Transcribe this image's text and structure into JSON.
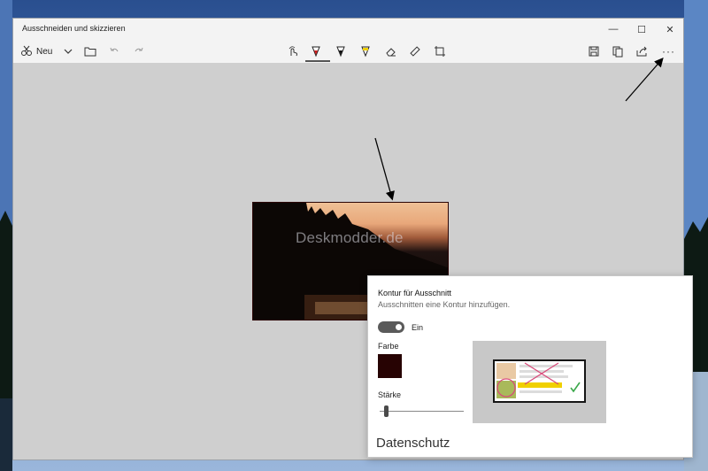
{
  "window": {
    "title": "Ausschneiden und skizzieren",
    "controls": {
      "minimize": "—",
      "maximize": "☐",
      "close": "✕"
    }
  },
  "toolbar": {
    "new_label": "Neu",
    "icons": [
      "new-snip-icon",
      "chevron-down-icon",
      "folder-icon",
      "undo-icon",
      "redo-icon",
      "touch-writing-icon",
      "ballpoint-pen-icon",
      "pencil-icon",
      "highlighter-icon",
      "eraser-icon",
      "ruler-icon",
      "crop-icon",
      "save-icon",
      "copy-icon",
      "share-icon",
      "more-icon"
    ],
    "more_label": "···"
  },
  "snip": {
    "watermark": "Deskmodder.de"
  },
  "flyout": {
    "title": "Kontur für Ausschnitt",
    "subtitle": "Ausschnitten eine Kontur hinzufügen.",
    "toggle_label": "Ein",
    "toggle_on": true,
    "color_label": "Farbe",
    "color_value": "#270303",
    "thickness_label": "Stärke",
    "thickness_level": 0.05,
    "section_heading": "Datenschutz"
  },
  "colors": {
    "pen_red": "#d21f1f",
    "highlighter_yellow": "#f0d000",
    "accent": "#555555"
  }
}
